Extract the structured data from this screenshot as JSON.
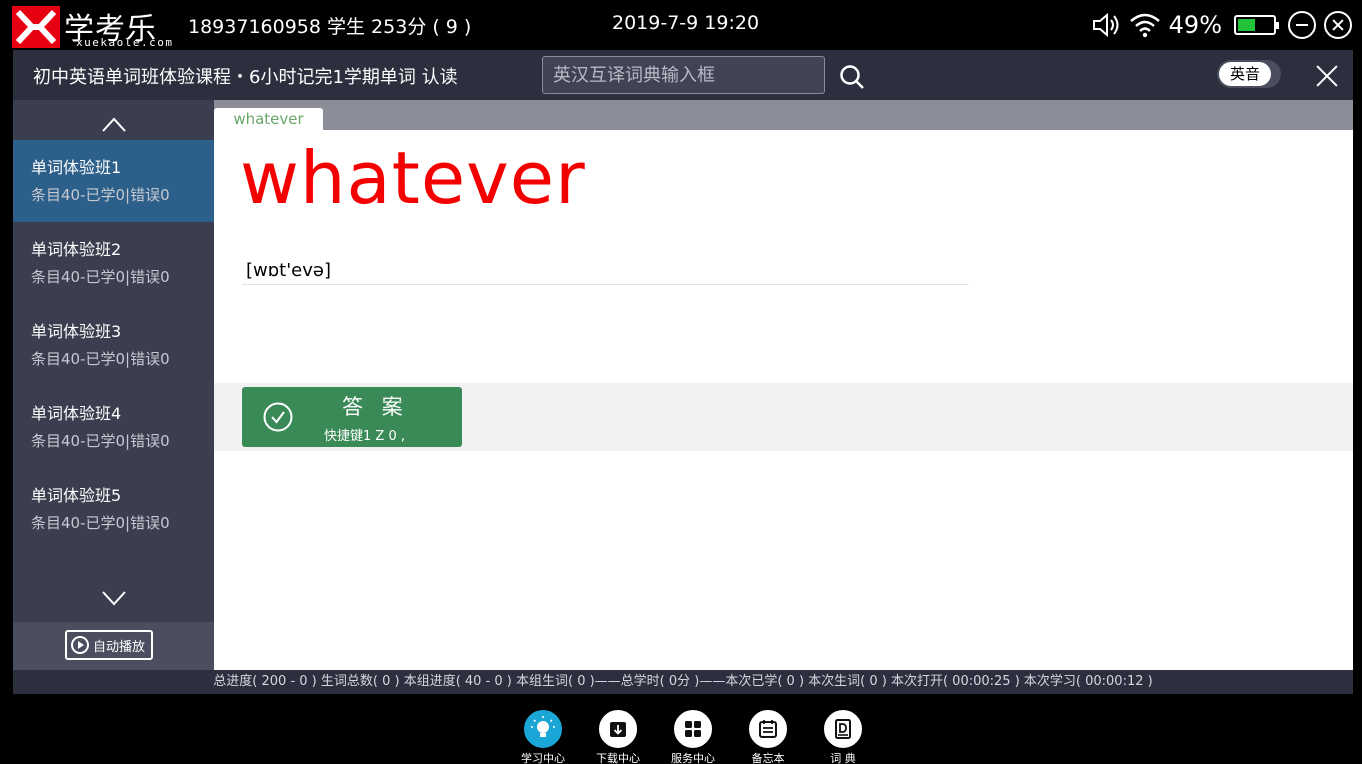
{
  "system": {
    "logo_cn": "学考乐",
    "logo_en": "xuekaole.com",
    "user_info": "18937160958 学生 253分 ( 9 )",
    "datetime": "2019-7-9 19:20",
    "battery_percent": "49%",
    "battery_level": 0.49
  },
  "titlebar": {
    "course_title": "初中英语单词班体验课程・6小时记完1学期单词 认读",
    "dict_placeholder": "英汉互译词典输入框",
    "accent_label": "英音"
  },
  "sidebar": {
    "items": [
      {
        "name": "单词体验班1",
        "stats": "条目40-已学0|错误0"
      },
      {
        "name": "单词体验班2",
        "stats": "条目40-已学0|错误0"
      },
      {
        "name": "单词体验班3",
        "stats": "条目40-已学0|错误0"
      },
      {
        "name": "单词体验班4",
        "stats": "条目40-已学0|错误0"
      },
      {
        "name": "单词体验班5",
        "stats": "条目40-已学0|错误0"
      }
    ],
    "autoplay_label": "自动播放"
  },
  "main": {
    "tab_label": "whatever",
    "word": "whatever",
    "phonetic": "[wɒt'evə]",
    "answer_label": "答 案",
    "answer_hint": "快捷键1 Z 0 ,"
  },
  "status_strip": "总进度( 200 - 0 )  生词总数( 0 )  本组进度( 40 - 0 )  本组生词( 0 )——总学时( 0分 )——本次已学( 0 )  本次生词( 0 )  本次打开( 00:00:25 )  本次学习( 00:00:12 )",
  "bottom_nav": [
    {
      "label": "学习中心",
      "icon": "lightbulb-icon",
      "active": true
    },
    {
      "label": "下载中心",
      "icon": "download-box-icon",
      "active": false
    },
    {
      "label": "服务中心",
      "icon": "grid-icon",
      "active": false
    },
    {
      "label": "备忘本",
      "icon": "calendar-icon",
      "active": false
    },
    {
      "label": "词 典",
      "icon": "dictionary-icon",
      "active": false
    }
  ],
  "colors": {
    "word": "#f40000",
    "active_sidebar": "#2c5f8a",
    "answer_button": "#3a8a57",
    "nav_active": "#1aa7d8",
    "battery": "#22c33a"
  }
}
